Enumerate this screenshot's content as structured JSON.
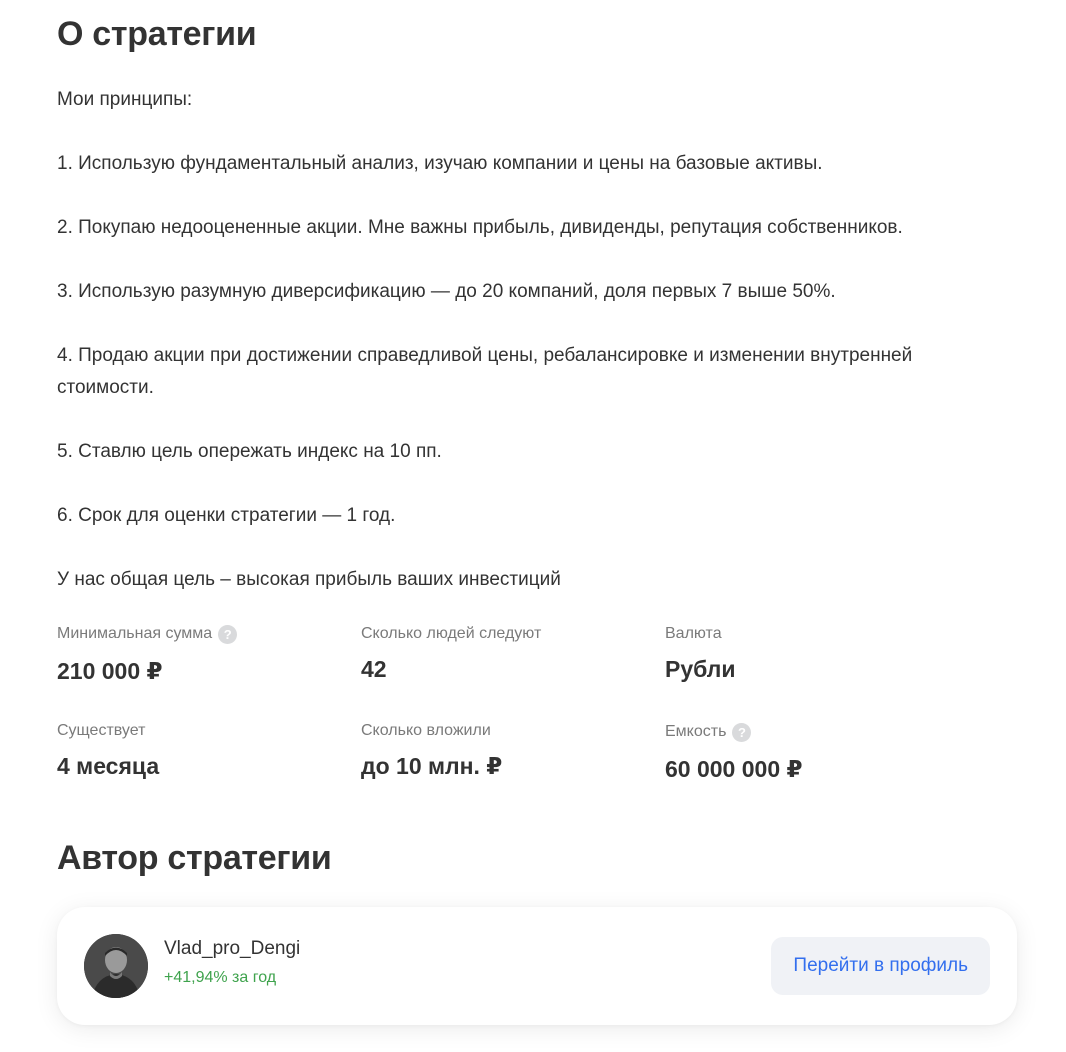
{
  "about": {
    "title": "О стратегии",
    "paragraphs": [
      "Мои принципы:",
      "1. Использую фундаментальный анализ, изучаю компании и цены на базовые активы.",
      "2. Покупаю недооцененные акции. Мне важны прибыль, дивиденды, репутация собственников.",
      "3. Использую разумную диверсификацию — до 20 компаний, доля первых 7 выше 50%.",
      "4. Продаю акции при достижении справедливой цены, ребалансировке и изменении внутренней стоимости.",
      "5. Ставлю цель опережать индекс на 10 пп.",
      "6. Срок для оценки стратегии — 1 год.",
      "У нас общая цель – высокая прибыль ваших инвестиций"
    ]
  },
  "stats": {
    "min_sum": {
      "label": "Минимальная сумма",
      "value": "210 000 ₽",
      "help_icon": "question-circle-icon"
    },
    "followers": {
      "label": "Сколько людей следуют",
      "value": "42"
    },
    "currency": {
      "label": "Валюта",
      "value": "Рубли"
    },
    "age": {
      "label": "Существует",
      "value": "4 месяца"
    },
    "invested": {
      "label": "Сколько вложили",
      "value": "до 10 млн. ₽"
    },
    "capacity": {
      "label": "Емкость",
      "value": "60 000 000 ₽",
      "help_icon": "question-circle-icon"
    }
  },
  "author": {
    "title": "Автор стратегии",
    "name": "Vlad_pro_Dengi",
    "yield": "+41,94% за год",
    "profile_button": "Перейти в профиль",
    "avatar_icon": "user-avatar-photo"
  },
  "colors": {
    "text_primary": "#333333",
    "text_secondary": "#7a7a7a",
    "positive": "#3fa34d",
    "link": "#336fee",
    "button_bg": "#f0f2f6"
  }
}
